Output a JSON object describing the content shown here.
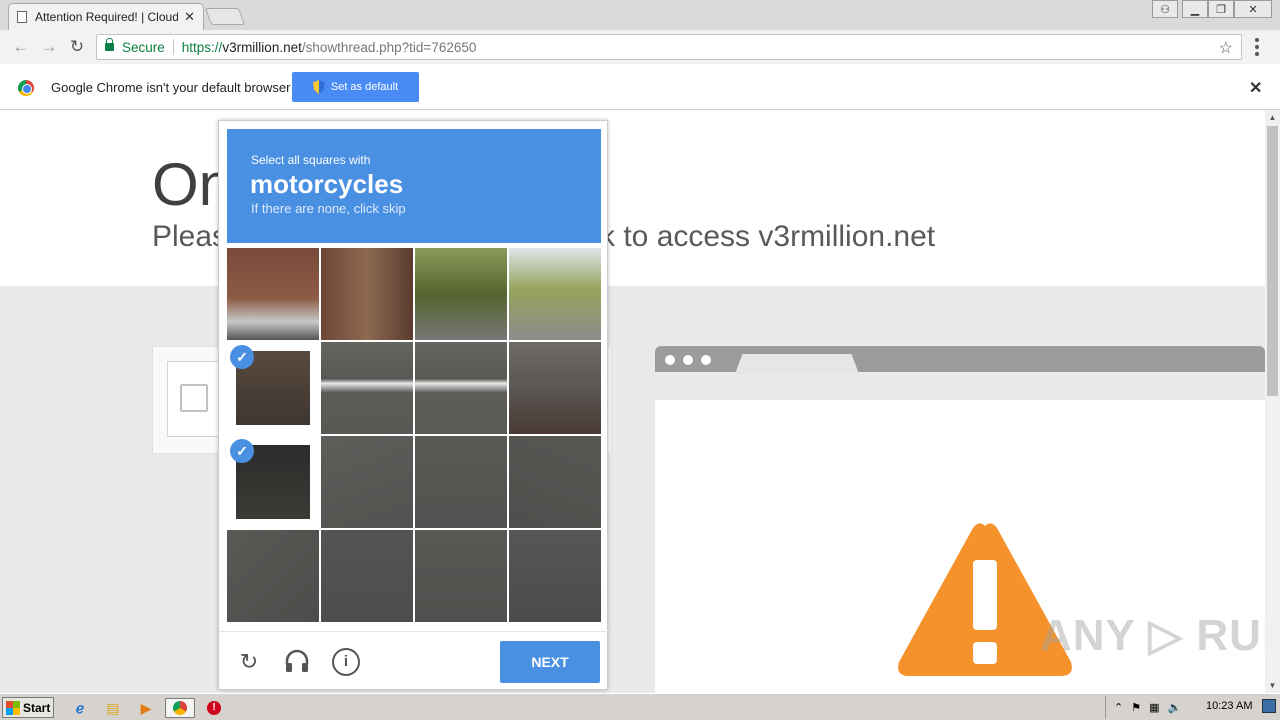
{
  "browser": {
    "tab_title": "Attention Required! | Cloudfl",
    "tab_close": "✕",
    "url_security_label": "Secure",
    "url_scheme": "https://",
    "url_host": "v3rmillion.net",
    "url_path": "/showthread.php?tid=762650",
    "icons": [
      "back-icon",
      "forward-icon",
      "reload-icon",
      "lock-icon",
      "star-icon",
      "menu-icon"
    ]
  },
  "infobar": {
    "message": "Google Chrome isn't your default browser",
    "button_label": "Set as default",
    "close": "✕"
  },
  "page": {
    "heading": "On",
    "subheading_left": "Pleas",
    "subheading_right": "k to access v3rmillion.net"
  },
  "captcha": {
    "prompt_small": "Select all squares with",
    "prompt_target": "motorcycles",
    "prompt_hint": "If there are none, click skip",
    "next_label": "NEXT",
    "selected_tiles": [
      4,
      8
    ],
    "check_glyph": "✓",
    "colors": {
      "accent": "#4a90e2"
    }
  },
  "watermark": "ANY ▷ RUN",
  "taskbar": {
    "start_label": "Start",
    "clock": "10:23 AM"
  }
}
